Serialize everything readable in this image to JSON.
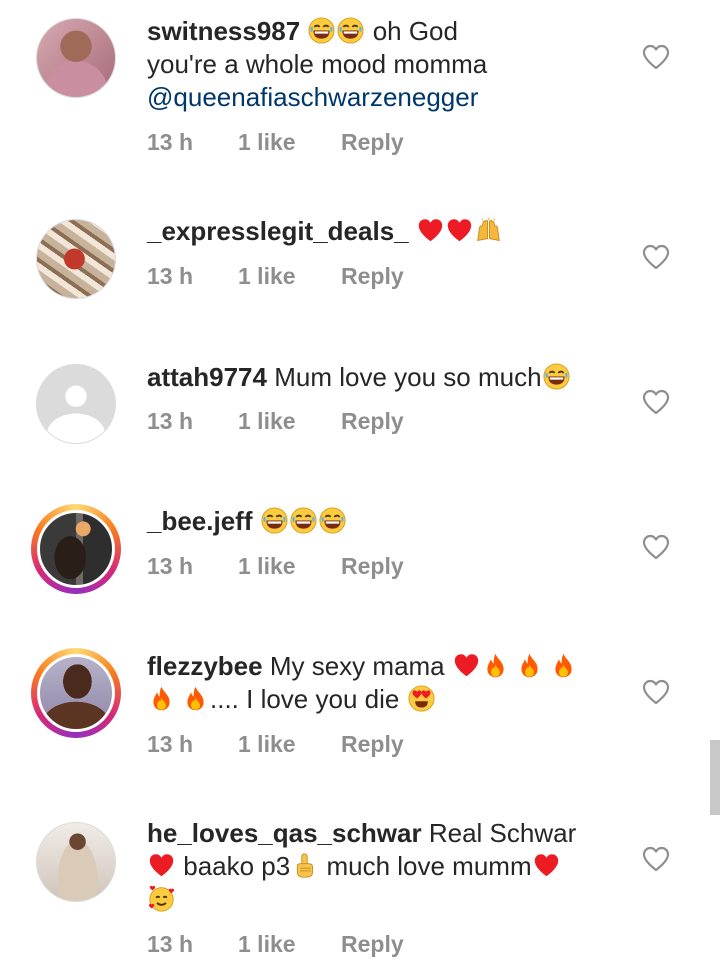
{
  "colors": {
    "text": "#262626",
    "meta": "#8e8e8e",
    "mention": "#00376b",
    "heart": "#ed1c24",
    "fire": "#ff5a00"
  },
  "comments": [
    {
      "username": "switness987",
      "text_1": "oh God",
      "text_2": "you're a whole mood momma",
      "mention": "@queenafiaschwarzenegger",
      "time": "13 h",
      "likes": "1 like",
      "reply": "Reply",
      "emojis": [
        "grinning-sweat-icon",
        "grinning-sweat-icon"
      ]
    },
    {
      "username": "_expresslegit_deals_",
      "time": "13 h",
      "likes": "1 like",
      "reply": "Reply",
      "emojis": [
        "red-heart-icon",
        "red-heart-icon",
        "raising-hands-icon"
      ]
    },
    {
      "username": "attah9774",
      "text_1": "Mum love you so much",
      "time": "13 h",
      "likes": "1 like",
      "reply": "Reply",
      "emojis": [
        "tears-of-joy-icon"
      ]
    },
    {
      "username": "_bee.jeff",
      "time": "13 h",
      "likes": "1 like",
      "reply": "Reply",
      "emojis": [
        "tears-of-joy-icon",
        "tears-of-joy-icon",
        "tears-of-joy-icon"
      ]
    },
    {
      "username": "flezzybee",
      "text_1": "My sexy mama",
      "text_2": ".... I love you die",
      "time": "13 h",
      "likes": "1 like",
      "reply": "Reply",
      "emojis": [
        "red-heart-icon",
        "fire-icon",
        "fire-icon",
        "fire-icon",
        "fire-icon",
        "fire-icon",
        "heart-eyes-icon"
      ]
    },
    {
      "username": "he_loves_qas_schwar",
      "text_1": "Real Schwar",
      "text_2": "baako p3",
      "text_3": "much love mumm",
      "time": "13 h",
      "likes": "1 like",
      "reply": "Reply",
      "emojis": [
        "red-heart-icon",
        "index-pointing-up-icon",
        "red-heart-icon",
        "smiling-hearts-icon"
      ]
    }
  ]
}
